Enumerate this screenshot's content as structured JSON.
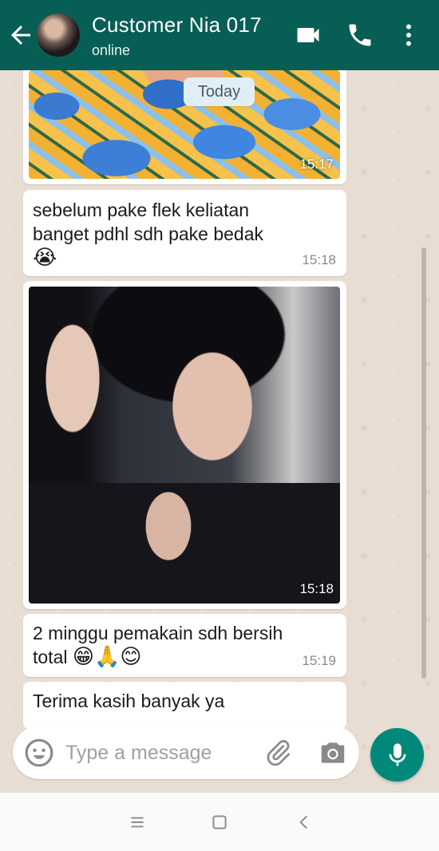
{
  "header": {
    "contact_name": "Customer Nia 017",
    "status": "online"
  },
  "chat": {
    "date_chip": "Today",
    "messages": [
      {
        "type": "image",
        "time": "15:17"
      },
      {
        "type": "text",
        "text": "sebelum pake flek keliatan banget pdhl sdh pake bedak",
        "emoji": "😭",
        "time": "15:18"
      },
      {
        "type": "image",
        "time": "15:18"
      },
      {
        "type": "text",
        "text": "2 minggu pemakain sdh bersih total",
        "emoji": "😁🙏😊",
        "time": "15:19"
      },
      {
        "type": "text",
        "text": "Terima kasih banyak ya",
        "time": ""
      }
    ]
  },
  "composer": {
    "placeholder": "Type a message"
  },
  "icons": {
    "back": "arrow-back-icon",
    "video": "video-camera-icon",
    "call": "phone-icon",
    "more": "more-vert-icon",
    "emoji": "smiley-icon",
    "attach": "paperclip-icon",
    "camera": "camera-icon",
    "mic": "mic-icon"
  },
  "colors": {
    "header": "#075e54",
    "mic_button": "#00897b",
    "bubble": "#ffffff",
    "date_chip": "#e1eef5"
  }
}
